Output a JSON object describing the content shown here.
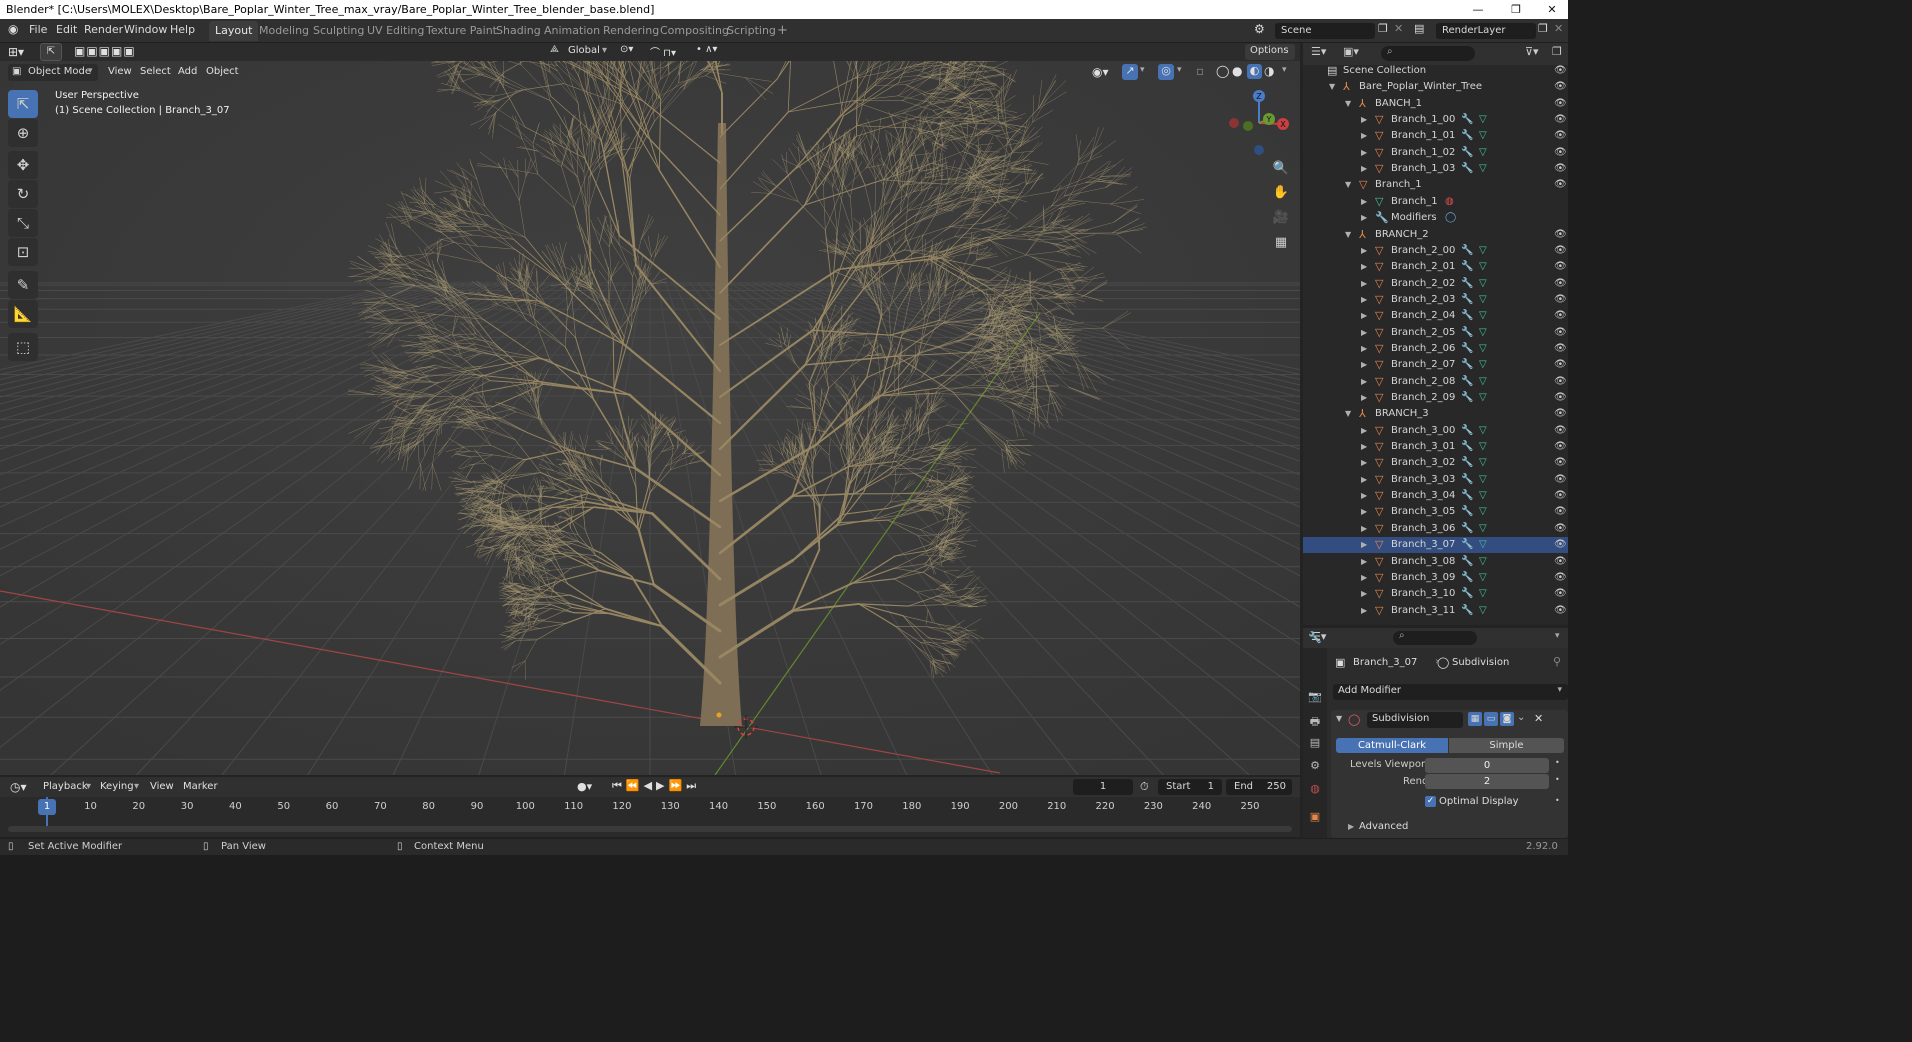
{
  "title_bar": {
    "text": "Blender* [C:\\Users\\MOLEX\\Desktop\\Bare_Poplar_Winter_Tree_max_vray/Bare_Poplar_Winter_Tree_blender_base.blend]",
    "minimize": "—",
    "maximize": "❐",
    "close": "✕"
  },
  "menu": [
    "File",
    "Edit",
    "Render",
    "Window",
    "Help"
  ],
  "workspaces": [
    "Layout",
    "Modeling",
    "Sculpting",
    "UV Editing",
    "Texture Paint",
    "Shading",
    "Animation",
    "Rendering",
    "Compositing",
    "Scripting"
  ],
  "add_workspace": "+",
  "scene": "Scene",
  "render_layer": "RenderLayer",
  "viewport": {
    "mode": "Object Mode",
    "menus": [
      "View",
      "Select",
      "Add",
      "Object"
    ],
    "transform_orientation": "Global",
    "options_label": "Options",
    "overlay_line1": "User Perspective",
    "overlay_line2": "(1) Scene Collection | Branch_3_07",
    "gizmo": {
      "z": "Z",
      "y": "Y",
      "x": "X"
    }
  },
  "outliner": {
    "search_placeholder": "",
    "rows": [
      {
        "label": "Scene Collection",
        "depth": 0,
        "kind": "collection",
        "expanded": true
      },
      {
        "label": "Bare_Poplar_Winter_Tree",
        "depth": 1,
        "kind": "empty",
        "expanded": true
      },
      {
        "label": "BANCH_1",
        "depth": 2,
        "kind": "empty",
        "expanded": true
      },
      {
        "label": "Branch_1_00",
        "depth": 3,
        "kind": "object"
      },
      {
        "label": "Branch_1_01",
        "depth": 3,
        "kind": "object"
      },
      {
        "label": "Branch_1_02",
        "depth": 3,
        "kind": "object"
      },
      {
        "label": "Branch_1_03",
        "depth": 3,
        "kind": "object"
      },
      {
        "label": "Branch_1",
        "depth": 2,
        "kind": "object",
        "expanded": true
      },
      {
        "label": "Branch_1",
        "depth": 3,
        "kind": "mesh"
      },
      {
        "label": "Modifiers",
        "depth": 3,
        "kind": "modifiers"
      },
      {
        "label": "BRANCH_2",
        "depth": 2,
        "kind": "empty",
        "expanded": true
      },
      {
        "label": "Branch_2_00",
        "depth": 3,
        "kind": "object"
      },
      {
        "label": "Branch_2_01",
        "depth": 3,
        "kind": "object"
      },
      {
        "label": "Branch_2_02",
        "depth": 3,
        "kind": "object"
      },
      {
        "label": "Branch_2_03",
        "depth": 3,
        "kind": "object"
      },
      {
        "label": "Branch_2_04",
        "depth": 3,
        "kind": "object"
      },
      {
        "label": "Branch_2_05",
        "depth": 3,
        "kind": "object"
      },
      {
        "label": "Branch_2_06",
        "depth": 3,
        "kind": "object"
      },
      {
        "label": "Branch_2_07",
        "depth": 3,
        "kind": "object"
      },
      {
        "label": "Branch_2_08",
        "depth": 3,
        "kind": "object"
      },
      {
        "label": "Branch_2_09",
        "depth": 3,
        "kind": "object"
      },
      {
        "label": "BRANCH_3",
        "depth": 2,
        "kind": "empty",
        "expanded": true
      },
      {
        "label": "Branch_3_00",
        "depth": 3,
        "kind": "object"
      },
      {
        "label": "Branch_3_01",
        "depth": 3,
        "kind": "object"
      },
      {
        "label": "Branch_3_02",
        "depth": 3,
        "kind": "object"
      },
      {
        "label": "Branch_3_03",
        "depth": 3,
        "kind": "object"
      },
      {
        "label": "Branch_3_04",
        "depth": 3,
        "kind": "object"
      },
      {
        "label": "Branch_3_05",
        "depth": 3,
        "kind": "object"
      },
      {
        "label": "Branch_3_06",
        "depth": 3,
        "kind": "object"
      },
      {
        "label": "Branch_3_07",
        "depth": 3,
        "kind": "object",
        "selected": true
      },
      {
        "label": "Branch_3_08",
        "depth": 3,
        "kind": "object"
      },
      {
        "label": "Branch_3_09",
        "depth": 3,
        "kind": "object"
      },
      {
        "label": "Branch_3_10",
        "depth": 3,
        "kind": "object"
      },
      {
        "label": "Branch_3_11",
        "depth": 3,
        "kind": "object"
      }
    ]
  },
  "properties": {
    "object_name": "Branch_3_07",
    "modifier_tab": "Subdivision",
    "add_modifier": "Add Modifier",
    "modifier_name": "Subdivision",
    "type_catmull": "Catmull-Clark",
    "type_simple": "Simple",
    "levels_viewport_label": "Levels Viewport",
    "levels_viewport_value": "0",
    "render_label": "Render",
    "render_value": "2",
    "optimal_display": "Optimal Display",
    "optimal_display_checked": true,
    "advanced": "Advanced"
  },
  "timeline": {
    "menus": [
      "Playback",
      "Keying",
      "View",
      "Marker"
    ],
    "current_frame": "1",
    "start_label": "Start",
    "start_value": "1",
    "end_label": "End",
    "end_value": "250",
    "ruler": [
      "1",
      "10",
      "20",
      "30",
      "40",
      "50",
      "60",
      "70",
      "80",
      "90",
      "100",
      "110",
      "120",
      "130",
      "140",
      "150",
      "160",
      "170",
      "180",
      "190",
      "200",
      "210",
      "220",
      "230",
      "240",
      "250"
    ]
  },
  "status": {
    "left": "Set Active Modifier",
    "middle": "Pan View",
    "right": "Context Menu",
    "version": "2.92.0"
  },
  "colors": {
    "accent": "#4772b3",
    "selection": "#334d80",
    "object_orange": "#e5894a",
    "mesh_green": "#3fc49a",
    "axis_red": "#b54040",
    "axis_green": "#6c9a2e"
  }
}
